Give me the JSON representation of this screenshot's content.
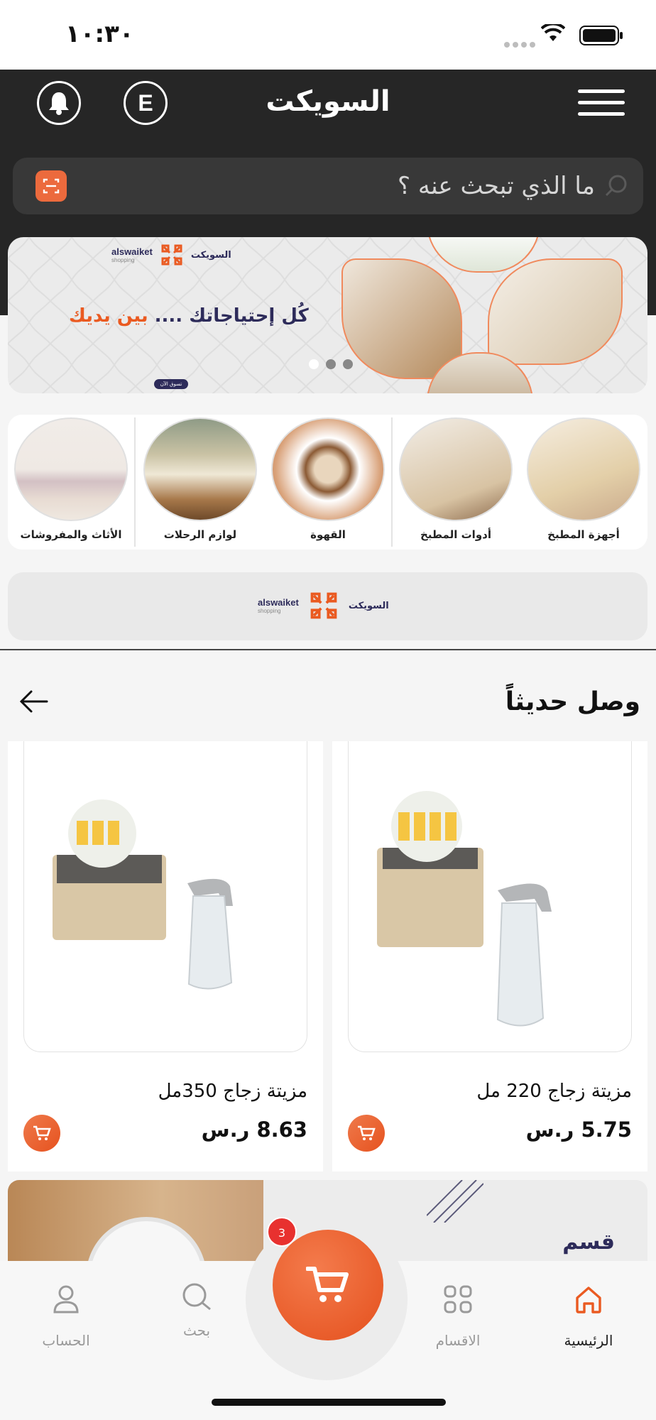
{
  "status_bar": {
    "time": "١٠:٣٠"
  },
  "header": {
    "title": "السويكت",
    "language_button": "E",
    "search_placeholder": "ما الذي تبحث عنه ؟"
  },
  "hero_banner": {
    "brand_en": "alswaiket",
    "brand_en_sub": "shopping",
    "brand_ar": "السويكت",
    "slogan_navy": "كُل إحتياجاتك ....",
    "slogan_orange": "بين يديك",
    "shop_now": "تسوق الآن",
    "slide_count": 3,
    "active_slide": 1
  },
  "categories": [
    {
      "label": "أجهزة المطبخ",
      "icon": "kitchen-appliances-image"
    },
    {
      "label": "أدوات المطبخ",
      "icon": "kitchen-tools-image"
    },
    {
      "label": "القهوة",
      "icon": "coffee-image"
    },
    {
      "label": "لوازم الرحلات",
      "icon": "camping-image"
    },
    {
      "label": "الأثاث والمفروشات",
      "icon": "furniture-image"
    }
  ],
  "secondary_banner": {
    "brand_en": "alswaiket",
    "brand_en_sub": "shopping",
    "brand_ar": "السويكت"
  },
  "new_arrivals": {
    "title": "وصل حديثاً",
    "products": [
      {
        "name": "مزيتة زجاج 220 مل",
        "price": "5.75 ر.س"
      },
      {
        "name": "مزيتة زجاج 350مل",
        "price": "8.63 ر.س"
      }
    ]
  },
  "promo": {
    "text": "قسم"
  },
  "cart_badge": "3",
  "bottom_nav": [
    {
      "label": "الرئيسية",
      "icon": "home-icon",
      "active": true
    },
    {
      "label": "الاقسام",
      "icon": "grid-icon",
      "active": false
    },
    {
      "label": "بحث",
      "icon": "search-icon",
      "active": false
    },
    {
      "label": "الحساب",
      "icon": "user-icon",
      "active": false
    }
  ],
  "colors": {
    "accent": "#ea5a21",
    "header_bg": "#262626",
    "navy": "#2d2b5a",
    "badge": "#e8312f"
  }
}
